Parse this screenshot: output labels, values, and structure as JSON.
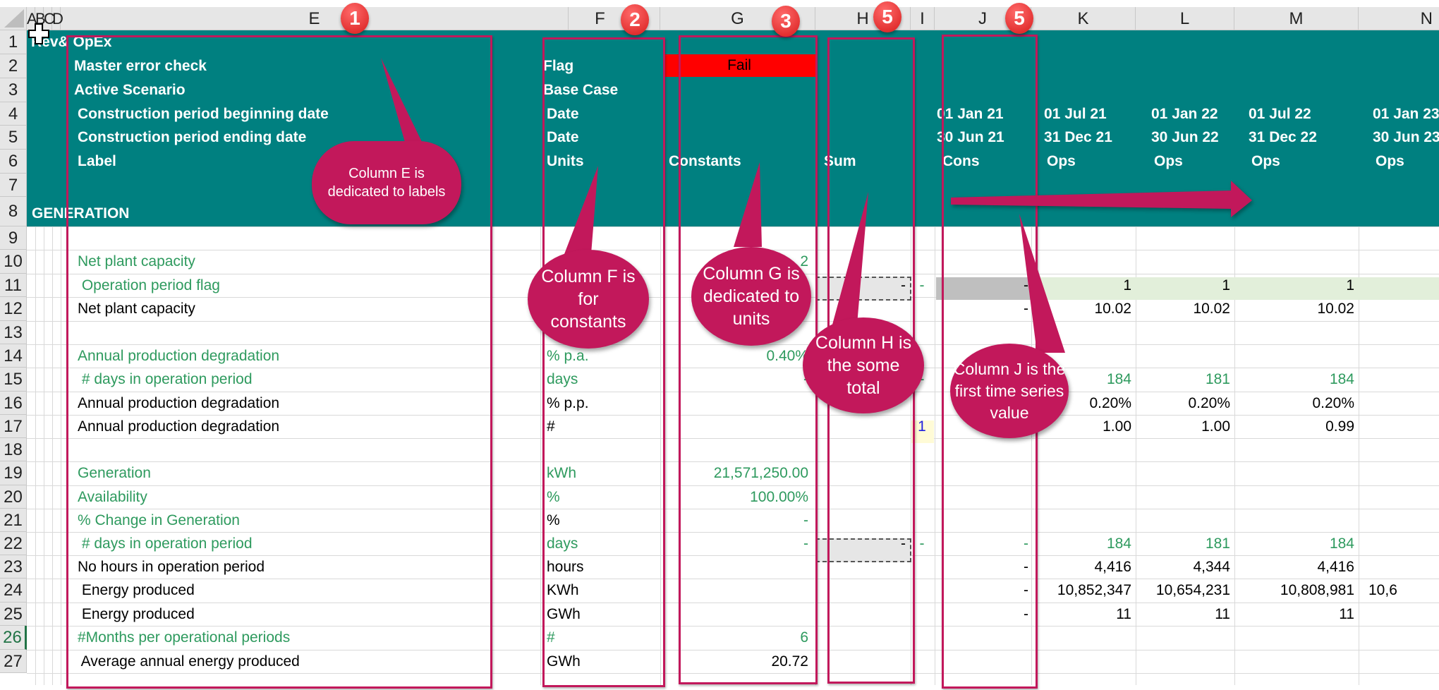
{
  "columns": [
    "A",
    "B",
    "C",
    "D",
    "E",
    "F",
    "G",
    "H",
    "I",
    "J",
    "K",
    "L",
    "M",
    "N"
  ],
  "rows": [
    "1",
    "2",
    "3",
    "4",
    "5",
    "6",
    "7",
    "8",
    "9",
    "10",
    "11",
    "12",
    "13",
    "14",
    "15",
    "16",
    "17",
    "18",
    "19",
    "20",
    "21",
    "22",
    "23",
    "24",
    "25",
    "26",
    "27"
  ],
  "selected_row": "26",
  "header": {
    "sheet_title": "Rev& OpEx",
    "master_error_label": "Master error check",
    "master_error_flag": "Flag",
    "master_error_status": "Fail",
    "scenario_label": "Active Scenario",
    "scenario_value": "Base Case",
    "begin_label": "Construction period beginning date",
    "begin_unit": "Date",
    "end_label": "Construction period ending date",
    "end_unit": "Date",
    "label_row_label": "Label",
    "label_row_units": "Units",
    "label_row_constants": "Constants",
    "label_row_sum": "Sum",
    "section": "GENERATION",
    "periods": [
      {
        "col": "J",
        "begin": "01 Jan 21",
        "end": "30 Jun 21",
        "label": "Cons"
      },
      {
        "col": "K",
        "begin": "01 Jul 21",
        "end": "31 Dec 21",
        "label": "Ops"
      },
      {
        "col": "L",
        "begin": "01 Jan 22",
        "end": "30 Jun 22",
        "label": "Ops"
      },
      {
        "col": "M",
        "begin": "01 Jul 22",
        "end": "31 Dec 22",
        "label": "Ops"
      },
      {
        "col": "N",
        "begin": "01 Jan 23",
        "end": "30 Jun 23",
        "label": "Ops"
      }
    ]
  },
  "body_rows": [
    {
      "row": "10",
      "label": "Net plant capacity",
      "unit": "",
      "constant": "2",
      "sum": "",
      "i": "",
      "j": "",
      "k": "",
      "l": "",
      "m": "",
      "n": "",
      "style": "g"
    },
    {
      "row": "11",
      "label": " Operation period flag",
      "unit": "",
      "constant": "",
      "sum": "-",
      "i": "-",
      "j": "-",
      "k": "1",
      "l": "1",
      "m": "1",
      "n": "",
      "style": "g"
    },
    {
      "row": "12",
      "label": "Net plant capacity",
      "unit": "",
      "constant": "",
      "sum": "",
      "i": "",
      "j": "-",
      "k": "10.02",
      "l": "10.02",
      "m": "10.02",
      "n": "",
      "style": "k"
    },
    {
      "row": "14",
      "label": "Annual production degradation",
      "unit": "% p.a.",
      "constant": "0.40%",
      "sum": "",
      "i": "",
      "j": "",
      "k": "",
      "l": "",
      "m": "",
      "n": "",
      "style": "g"
    },
    {
      "row": "15",
      "label": " # days in operation period",
      "unit": "days",
      "constant": "-",
      "sum": "",
      "i": "-",
      "j": "",
      "k": "184",
      "l": "181",
      "m": "184",
      "n": "",
      "style": "g"
    },
    {
      "row": "16",
      "label": "Annual production degradation",
      "unit": "% p.p.",
      "constant": "",
      "sum": "",
      "i": "",
      "j": "",
      "k": "0.20%",
      "l": "0.20%",
      "m": "0.20%",
      "n": "",
      "style": "k"
    },
    {
      "row": "17",
      "label": "Annual production degradation",
      "unit": "#",
      "constant": "",
      "sum": "",
      "i": "1",
      "j": "",
      "k": "1.00",
      "l": "1.00",
      "m": "0.99",
      "n": "",
      "style": "k"
    },
    {
      "row": "19",
      "label": "Generation",
      "unit": "kWh",
      "constant": "21,571,250.00",
      "sum": "",
      "i": "",
      "j": "",
      "k": "",
      "l": "",
      "m": "",
      "n": "",
      "style": "g"
    },
    {
      "row": "20",
      "label": "Availability",
      "unit": "%",
      "constant": "100.00%",
      "sum": "",
      "i": "",
      "j": "",
      "k": "",
      "l": "",
      "m": "",
      "n": "",
      "style": "g"
    },
    {
      "row": "21",
      "label": "% Change in Generation",
      "unit": "%",
      "constant": "-",
      "sum": "",
      "i": "",
      "j": "",
      "k": "",
      "l": "",
      "m": "",
      "n": "",
      "style": "g"
    },
    {
      "row": "22",
      "label": " # days in operation period",
      "unit": "days",
      "constant": "-",
      "sum": "-",
      "i": "-",
      "j": "-",
      "k": "184",
      "l": "181",
      "m": "184",
      "n": "",
      "style": "g"
    },
    {
      "row": "23",
      "label": "No hours in operation period",
      "unit": "hours",
      "constant": "",
      "sum": "",
      "i": "",
      "j": "-",
      "k": "4,416",
      "l": "4,344",
      "m": "4,416",
      "n": "",
      "style": "k"
    },
    {
      "row": "24",
      "label": " Energy produced",
      "unit": "KWh",
      "constant": "",
      "sum": "",
      "i": "",
      "j": "-",
      "k": "10,852,347",
      "l": "10,654,231",
      "m": "10,808,981",
      "n": "10,6",
      "style": "k"
    },
    {
      "row": "25",
      "label": " Energy produced",
      "unit": "GWh",
      "constant": "",
      "sum": "",
      "i": "",
      "j": "-",
      "k": "11",
      "l": "11",
      "m": "11",
      "n": "",
      "style": "k"
    },
    {
      "row": "26",
      "label": "#Months per operational periods",
      "unit": "#",
      "constant": "6",
      "sum": "",
      "i": "",
      "j": "",
      "k": "",
      "l": "",
      "m": "",
      "n": "",
      "style": "g"
    },
    {
      "row": "27",
      "label": " Average annual energy produced",
      "unit": "GWh",
      "constant": "20.72",
      "sum": "",
      "i": "",
      "j": "",
      "k": "",
      "l": "",
      "m": "",
      "n": "",
      "style": "k"
    }
  ],
  "annotations": {
    "badges": [
      "1",
      "2",
      "3",
      "5",
      "5"
    ],
    "callout_e": [
      "Column E is",
      "dedicated to labels"
    ],
    "callout_f": [
      "Column F is",
      "for",
      "constants"
    ],
    "callout_g": [
      "Column G is",
      "dedicated to",
      "units"
    ],
    "callout_h": [
      "Column H is",
      "the some",
      "total"
    ],
    "callout_j": [
      "Column J is the",
      "first time series",
      "value"
    ]
  },
  "colors": {
    "header_teal": "#008080",
    "annotation_magenta": "#c2185b",
    "fail_red": "#ff0000",
    "input_green": "#2e9a5e",
    "flag_band_green": "#e2efda"
  }
}
